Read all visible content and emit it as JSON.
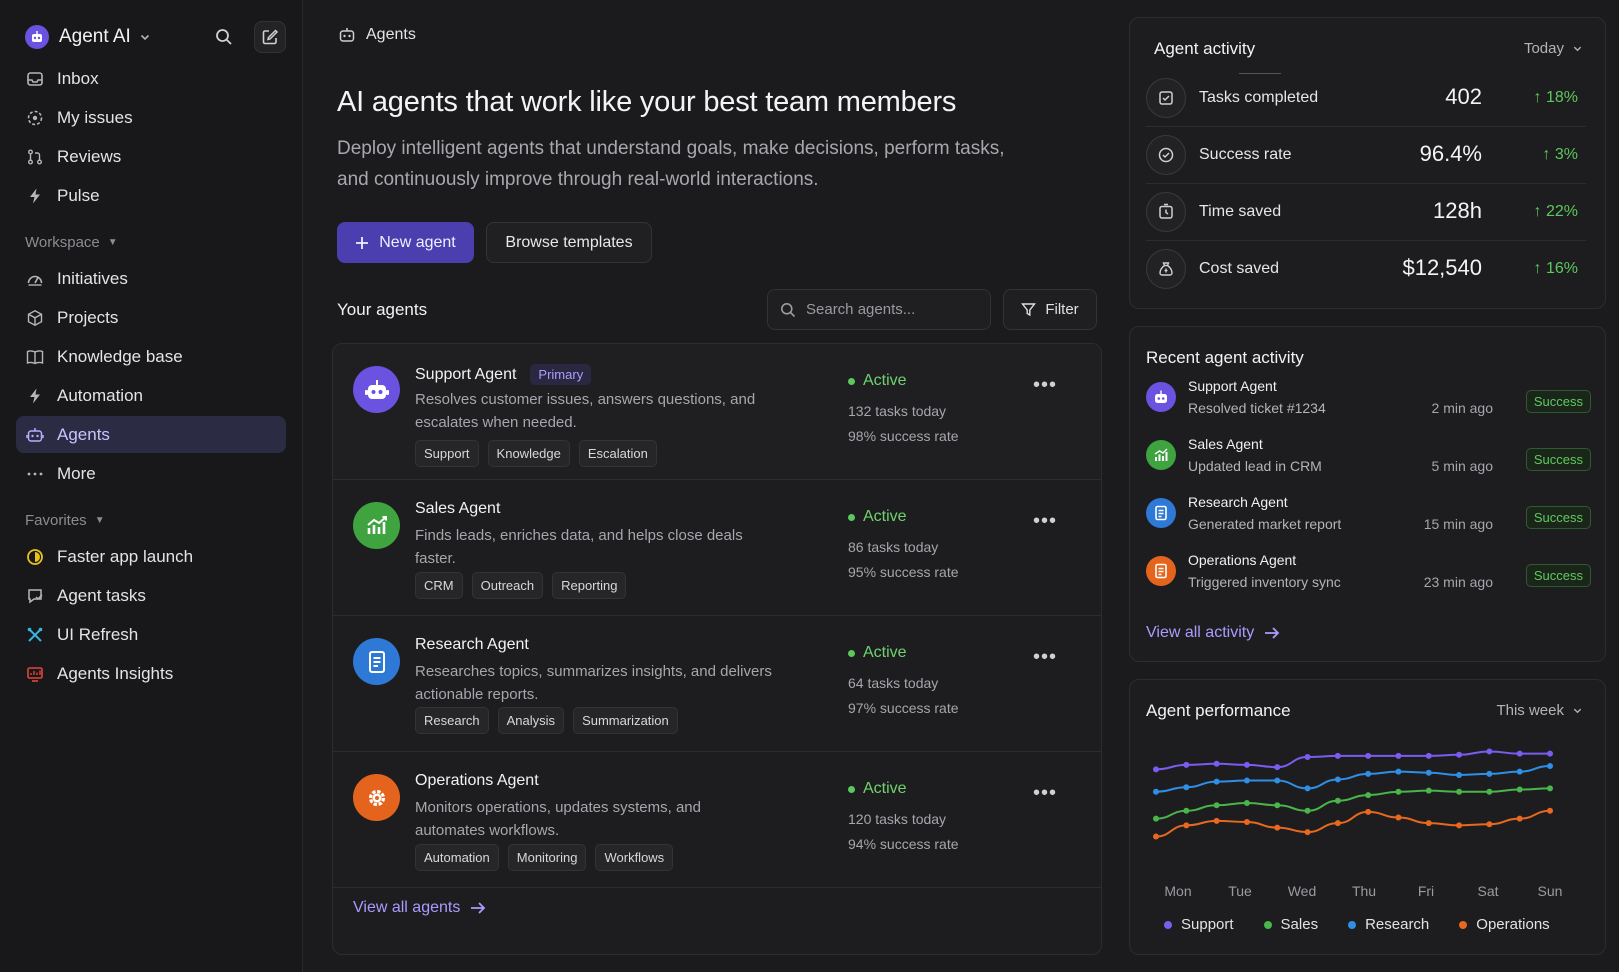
{
  "sidebar": {
    "workspace_name": "Agent AI",
    "nav": [
      {
        "label": "Inbox"
      },
      {
        "label": "My issues"
      },
      {
        "label": "Reviews"
      },
      {
        "label": "Pulse"
      }
    ],
    "workspace_label": "Workspace",
    "workspace_items": [
      {
        "label": "Initiatives"
      },
      {
        "label": "Projects"
      },
      {
        "label": "Knowledge base"
      },
      {
        "label": "Automation"
      },
      {
        "label": "Agents"
      },
      {
        "label": "More"
      }
    ],
    "favorites_label": "Favorites",
    "favorites": [
      {
        "label": "Faster app launch",
        "color": "#e8c21b"
      },
      {
        "label": "Agent tasks",
        "color": "#b6b6bb"
      },
      {
        "label": "UI Refresh",
        "color": "#35b7e0"
      },
      {
        "label": "Agents Insights",
        "color": "#e0453a"
      }
    ]
  },
  "main": {
    "breadcrumb": "Agents",
    "headline": "AI agents that work like your best team members",
    "subline": "Deploy intelligent agents that understand goals, make decisions, perform tasks, and continuously improve through real-world interactions.",
    "new_agent_label": "New agent",
    "browse_label": "Browse templates",
    "your_agents_label": "Your agents",
    "search_placeholder": "Search agents...",
    "filter_label": "Filter",
    "agents": [
      {
        "name": "Support Agent",
        "badge": "Primary",
        "desc": "Resolves customer issues, answers questions, and escalates when needed.",
        "tags": [
          "Support",
          "Knowledge",
          "Escalation"
        ],
        "status": "Active",
        "tasks": "132 tasks today",
        "rate": "98% success rate",
        "color": "#6c52e0"
      },
      {
        "name": "Sales Agent",
        "badge": "",
        "desc": "Finds leads, enriches data, and helps close deals faster.",
        "tags": [
          "CRM",
          "Outreach",
          "Reporting"
        ],
        "status": "Active",
        "tasks": "86 tasks today",
        "rate": "95% success rate",
        "color": "#3fa33f"
      },
      {
        "name": "Research Agent",
        "badge": "",
        "desc": "Researches topics, summarizes insights, and delivers actionable reports.",
        "tags": [
          "Research",
          "Analysis",
          "Summarization"
        ],
        "status": "Active",
        "tasks": "64 tasks today",
        "rate": "97% success rate",
        "color": "#2e78d6"
      },
      {
        "name": "Operations Agent",
        "badge": "",
        "desc": "Monitors operations, updates systems, and automates workflows.",
        "tags": [
          "Automation",
          "Monitoring",
          "Workflows"
        ],
        "status": "Active",
        "tasks": "120 tasks today",
        "rate": "94% success rate",
        "color": "#e4641e"
      }
    ],
    "view_all_agents": "View all agents"
  },
  "activity": {
    "title": "Agent activity",
    "range": "Today",
    "metrics": [
      {
        "label": "Tasks completed",
        "value": "402",
        "delta": "↑ 18%"
      },
      {
        "label": "Success rate",
        "value": "96.4%",
        "delta": "↑ 3%"
      },
      {
        "label": "Time saved",
        "value": "128h",
        "delta": "↑ 22%"
      },
      {
        "label": "Cost saved",
        "value": "$12,540",
        "delta": "↑ 16%"
      }
    ]
  },
  "recent": {
    "title": "Recent agent activity",
    "items": [
      {
        "name": "Support Agent",
        "desc": "Resolved ticket #1234",
        "time": "2 min ago",
        "status": "Success",
        "color": "#6c52e0"
      },
      {
        "name": "Sales Agent",
        "desc": "Updated lead in CRM",
        "time": "5 min ago",
        "status": "Success",
        "color": "#3fa33f"
      },
      {
        "name": "Research Agent",
        "desc": "Generated market report",
        "time": "15 min ago",
        "status": "Success",
        "color": "#2e78d6"
      },
      {
        "name": "Operations Agent",
        "desc": "Triggered inventory sync",
        "time": "23 min ago",
        "status": "Success",
        "color": "#e4641e"
      }
    ],
    "view_all": "View all activity"
  },
  "performance": {
    "title": "Agent performance",
    "range": "This week"
  },
  "chart_data": {
    "type": "line",
    "categories": [
      "Mon",
      "Tue",
      "Wed",
      "Thu",
      "Fri",
      "Sat",
      "Sun"
    ],
    "grid": false,
    "legend": "bottom",
    "ylim": [
      0,
      100
    ],
    "series": [
      {
        "name": "Support",
        "color": "#7b5cf0",
        "values": [
          72,
          76,
          77,
          76,
          74,
          83,
          84,
          84,
          84,
          84,
          85,
          88,
          86,
          86
        ]
      },
      {
        "name": "Sales",
        "color": "#49b54a",
        "values": [
          28,
          35,
          40,
          42,
          40,
          35,
          44,
          49,
          52,
          53,
          52,
          52,
          54,
          55
        ]
      },
      {
        "name": "Research",
        "color": "#2f8fe6",
        "values": [
          52,
          56,
          61,
          62,
          62,
          55,
          63,
          68,
          70,
          69,
          67,
          68,
          70,
          75
        ]
      },
      {
        "name": "Operations",
        "color": "#e8681f",
        "values": [
          12,
          22,
          26,
          25,
          20,
          16,
          24,
          34,
          29,
          24,
          22,
          23,
          28,
          35
        ]
      }
    ]
  }
}
